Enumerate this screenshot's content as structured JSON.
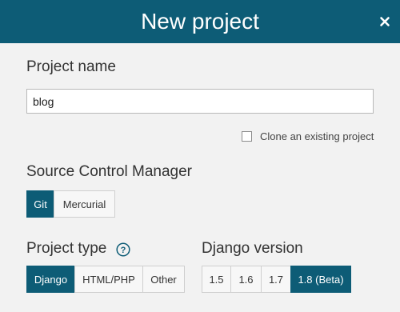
{
  "header": {
    "title": "New project",
    "close_icon": "close-icon"
  },
  "project_name": {
    "label": "Project name",
    "value": "blog"
  },
  "clone": {
    "label": "Clone an existing project",
    "checked": false
  },
  "scm": {
    "label": "Source Control Manager",
    "options": [
      "Git",
      "Mercurial"
    ],
    "selected": "Git"
  },
  "project_type": {
    "label": "Project type",
    "help_icon": "help-icon",
    "options": [
      "Django",
      "HTML/PHP",
      "Other"
    ],
    "selected": "Django"
  },
  "django_version": {
    "label": "Django version",
    "options": [
      "1.5",
      "1.6",
      "1.7",
      "1.8 (Beta)"
    ],
    "selected": "1.8 (Beta)"
  },
  "colors": {
    "accent": "#0d5c76",
    "background": "#f2f2f2"
  }
}
